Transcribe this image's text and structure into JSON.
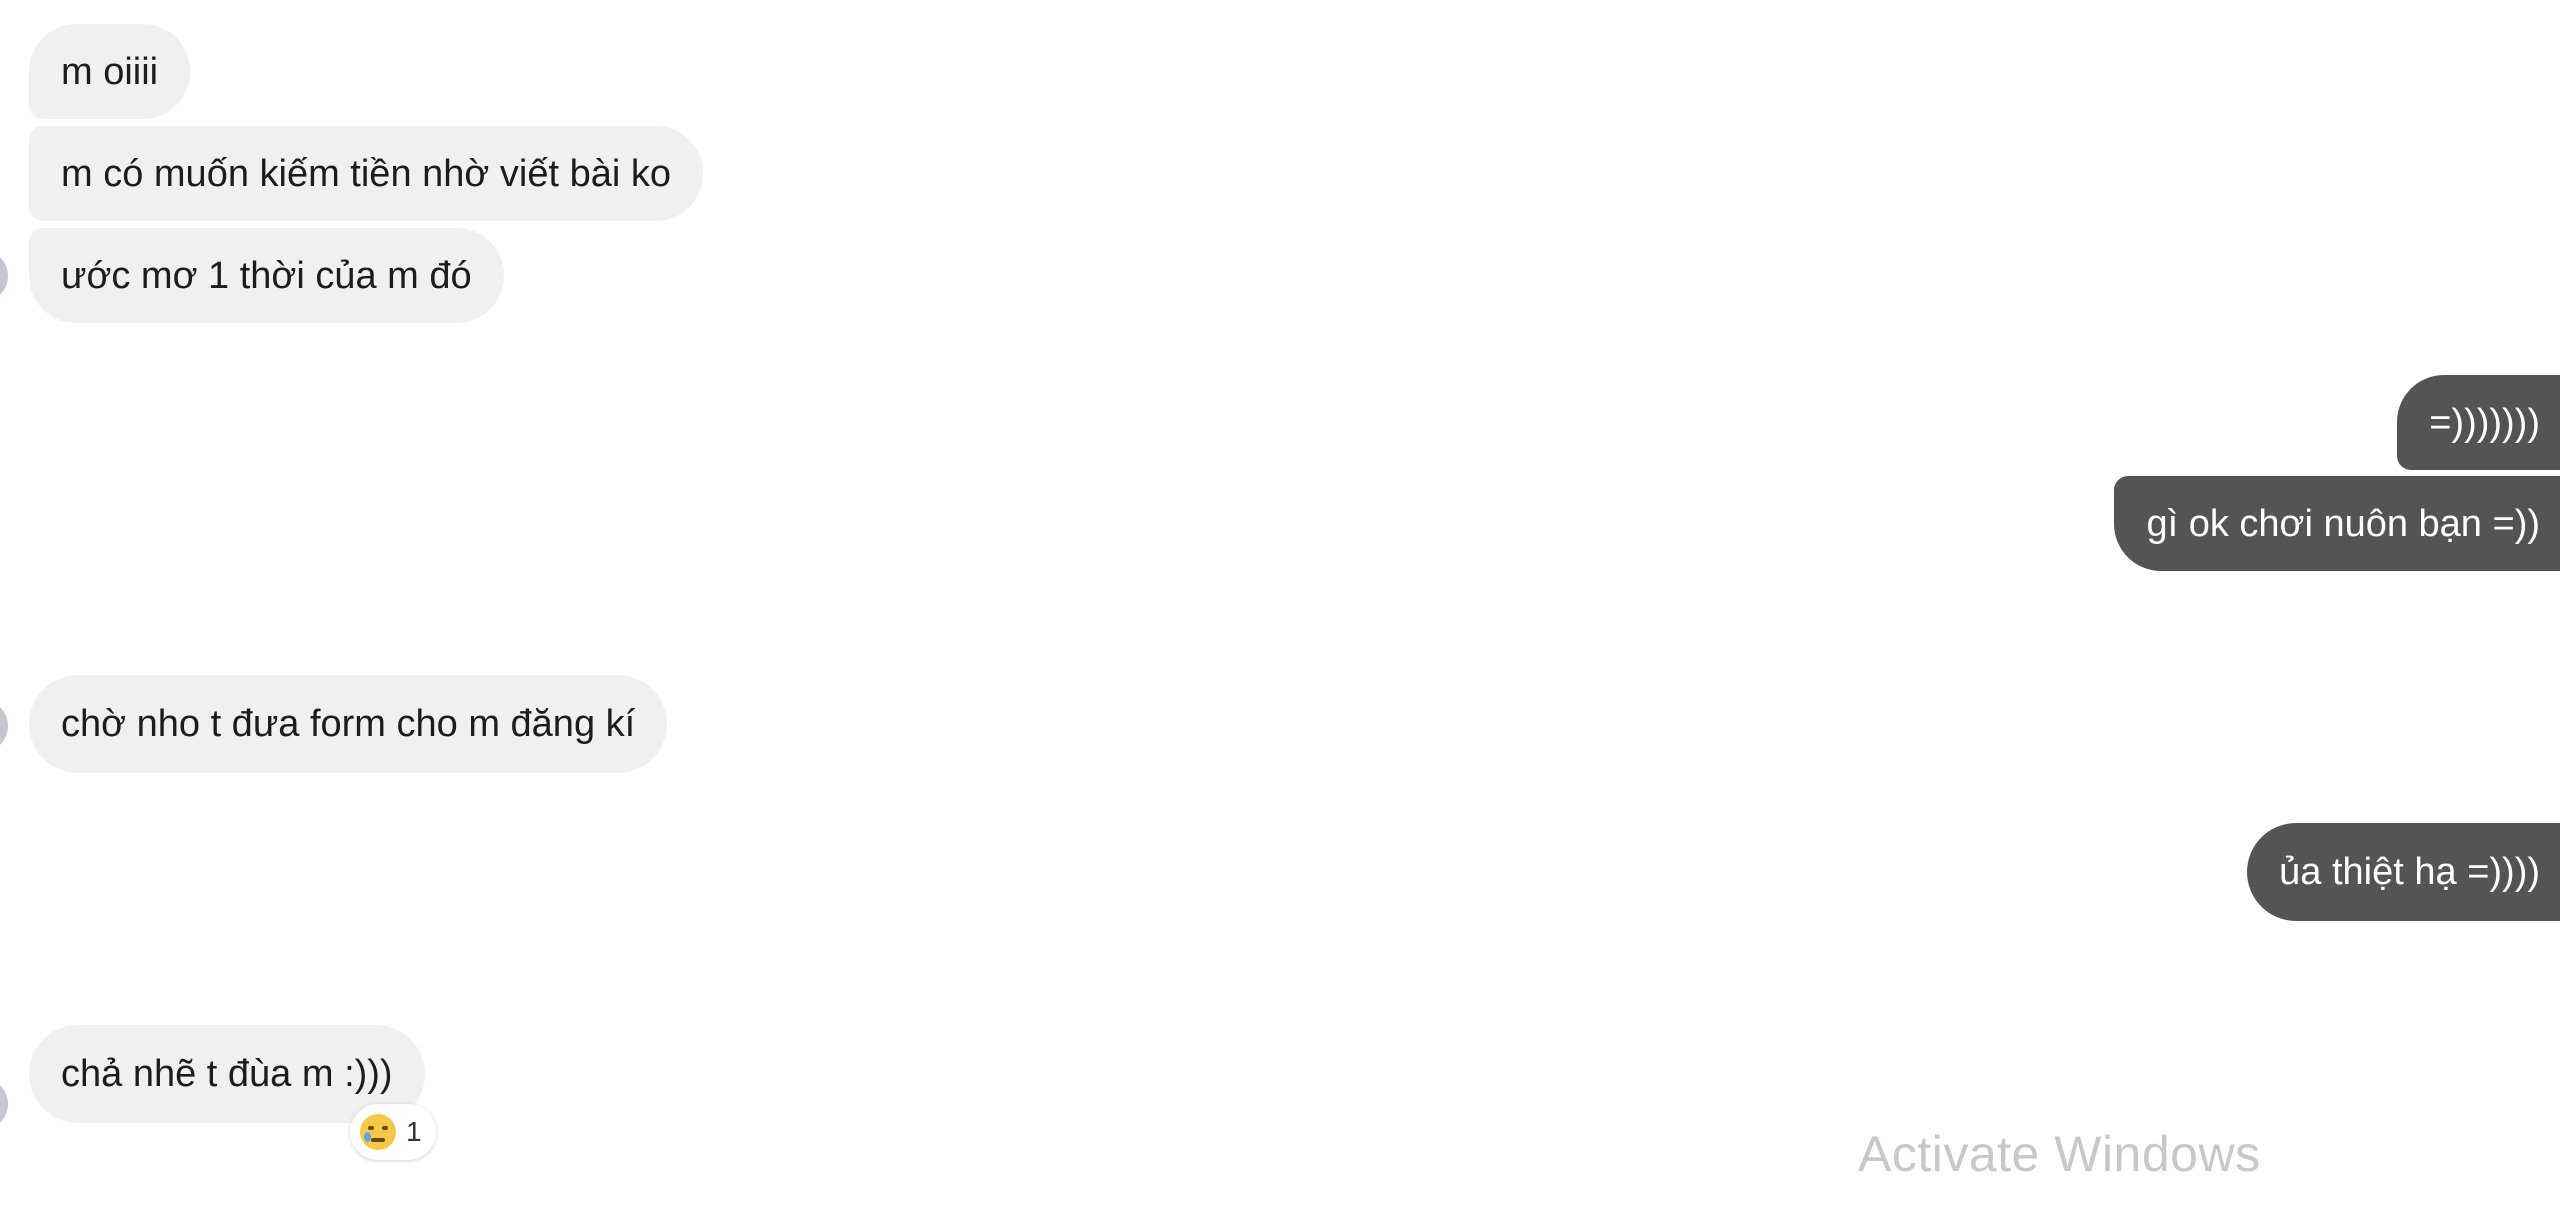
{
  "messages": {
    "incoming": [
      {
        "text": "m oiiii"
      },
      {
        "text": "m có muốn kiếm tiền nhờ viết bài ko"
      },
      {
        "text": "ước mơ 1 thời của m đó"
      },
      {
        "text": "chờ nho t đưa form cho m đăng kí"
      },
      {
        "text": "chả nhẽ t đùa m :)))"
      }
    ],
    "outgoing": [
      {
        "text": "=)))))))"
      },
      {
        "text": "gì ok chơi nuôn bạn =))"
      },
      {
        "text": "ủa thiệt hạ =))))"
      }
    ]
  },
  "reaction": {
    "icon": "crying-face-icon",
    "count": "1"
  },
  "watermark": {
    "text": "Activate Windows"
  },
  "colors": {
    "incoming_bubble": "#f0f0f0",
    "outgoing_bubble": "#545454",
    "watermark": "#c8c8c8"
  }
}
